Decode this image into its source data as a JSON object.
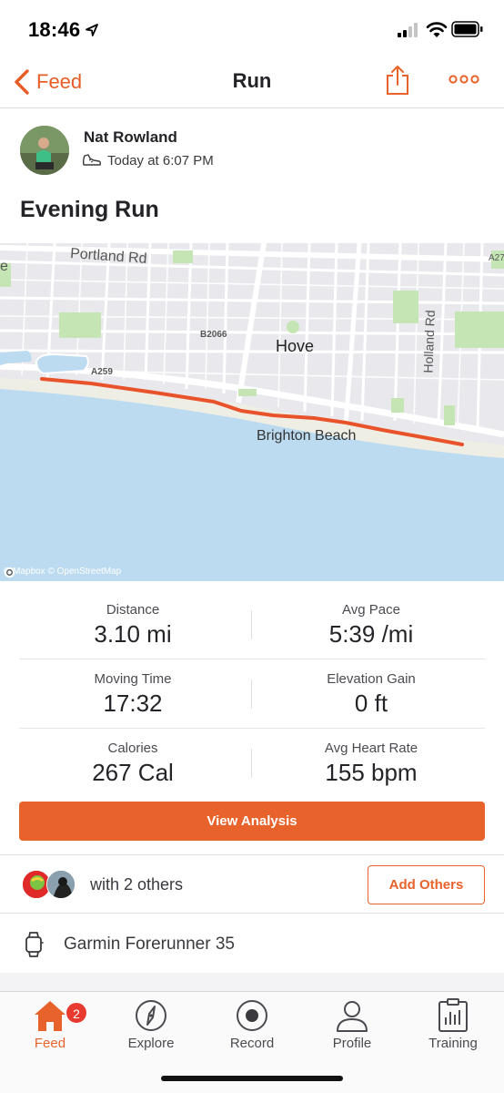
{
  "status_bar": {
    "time": "18:46"
  },
  "nav": {
    "back_label": "Feed",
    "title": "Run",
    "share_icon": "share-icon",
    "more_icon": "more-icon"
  },
  "athlete": {
    "name": "Nat Rowland",
    "time": "Today at 6:07 PM",
    "activity_icon": "shoe-icon"
  },
  "activity": {
    "title": "Evening Run"
  },
  "map": {
    "labels": {
      "portland_rd": "Portland Rd",
      "b2066": "B2066",
      "hove": "Hove",
      "holland_rd": "Holland Rd",
      "a259": "A259",
      "brighton_beach": "Brighton Beach",
      "a27": "A27",
      "edge_e": "e"
    },
    "attribution": "© Mapbox © OpenStreetMap",
    "colors": {
      "sea": "#bcdbf0",
      "land": "#e8e8ec",
      "park": "#c5e6b4",
      "route": "#e8532b"
    }
  },
  "stats": [
    {
      "label": "Distance",
      "value": "3.10 mi"
    },
    {
      "label": "Avg Pace",
      "value": "5:39 /mi"
    },
    {
      "label": "Moving Time",
      "value": "17:32"
    },
    {
      "label": "Elevation Gain",
      "value": "0 ft"
    },
    {
      "label": "Calories",
      "value": "267 Cal"
    },
    {
      "label": "Avg Heart Rate",
      "value": "155 bpm"
    }
  ],
  "analysis_button": "View Analysis",
  "group": {
    "text": "with 2 others",
    "add_button": "Add Others"
  },
  "device": {
    "name": "Garmin Forerunner 35"
  },
  "tabs": [
    {
      "label": "Feed",
      "icon": "home-icon",
      "badge": "2"
    },
    {
      "label": "Explore",
      "icon": "compass-icon"
    },
    {
      "label": "Record",
      "icon": "record-icon"
    },
    {
      "label": "Profile",
      "icon": "profile-icon"
    },
    {
      "label": "Training",
      "icon": "training-icon"
    }
  ],
  "colors": {
    "accent": "#e8632b",
    "badge": "#e83a2e"
  }
}
